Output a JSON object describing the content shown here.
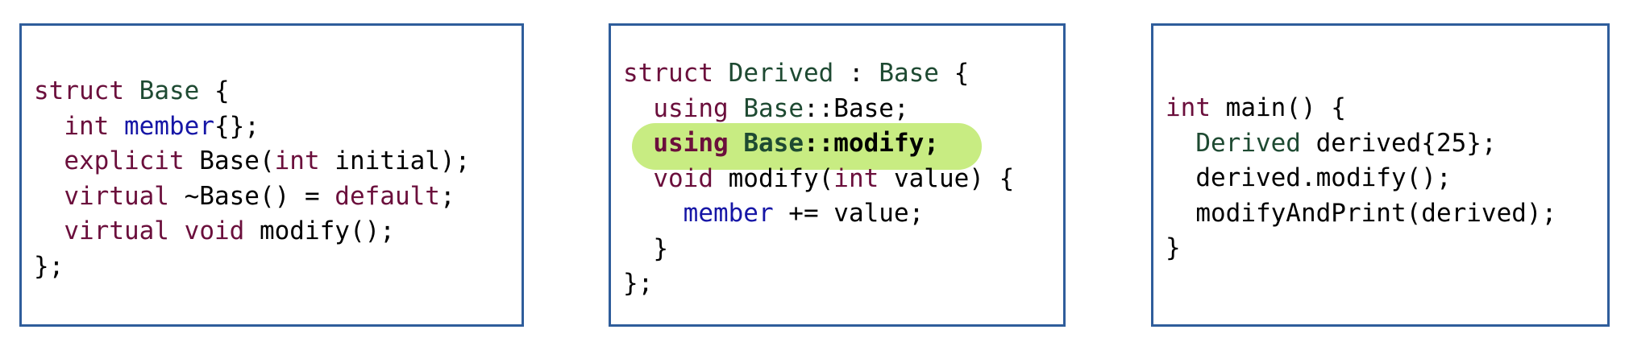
{
  "boxes": {
    "base": {
      "lines": [
        [
          {
            "t": "struct ",
            "c": "kw"
          },
          {
            "t": "Base",
            "c": "ty"
          },
          {
            "t": " {",
            "c": "tx"
          }
        ],
        [
          {
            "t": "  ",
            "c": "tx"
          },
          {
            "t": "int",
            "c": "kw"
          },
          {
            "t": " ",
            "c": "tx"
          },
          {
            "t": "member",
            "c": "mb"
          },
          {
            "t": "{};",
            "c": "tx"
          }
        ],
        [
          {
            "t": "  ",
            "c": "tx"
          },
          {
            "t": "explicit",
            "c": "kw"
          },
          {
            "t": " Base(",
            "c": "tx"
          },
          {
            "t": "int",
            "c": "kw"
          },
          {
            "t": " initial);",
            "c": "tx"
          }
        ],
        [
          {
            "t": "  ",
            "c": "tx"
          },
          {
            "t": "virtual",
            "c": "kw"
          },
          {
            "t": " ~Base() = ",
            "c": "tx"
          },
          {
            "t": "default",
            "c": "kw"
          },
          {
            "t": ";",
            "c": "tx"
          }
        ],
        [
          {
            "t": "  ",
            "c": "tx"
          },
          {
            "t": "virtual",
            "c": "kw"
          },
          {
            "t": " ",
            "c": "tx"
          },
          {
            "t": "void",
            "c": "kw"
          },
          {
            "t": " modify();",
            "c": "tx"
          }
        ],
        [
          {
            "t": "};",
            "c": "tx"
          }
        ]
      ]
    },
    "derived": {
      "lines": [
        [
          {
            "t": "struct ",
            "c": "kw"
          },
          {
            "t": "Derived",
            "c": "ty"
          },
          {
            "t": " : ",
            "c": "tx"
          },
          {
            "t": "Base",
            "c": "ty"
          },
          {
            "t": " {",
            "c": "tx"
          }
        ],
        [
          {
            "t": "  ",
            "c": "tx"
          },
          {
            "t": "using",
            "c": "kw"
          },
          {
            "t": " ",
            "c": "tx"
          },
          {
            "t": "Base",
            "c": "ty"
          },
          {
            "t": "::Base;",
            "c": "tx"
          }
        ],
        [
          {
            "t": "  ",
            "c": "tx"
          },
          {
            "t": "using",
            "c": "kw",
            "hl": true
          },
          {
            "t": " ",
            "c": "tx",
            "hl": true
          },
          {
            "t": "Base",
            "c": "ty",
            "hl": true
          },
          {
            "t": "::modify;",
            "c": "tx",
            "hl": true
          }
        ],
        [
          {
            "t": "  ",
            "c": "tx"
          },
          {
            "t": "void",
            "c": "kw"
          },
          {
            "t": " modify(",
            "c": "tx"
          },
          {
            "t": "int",
            "c": "kw"
          },
          {
            "t": " value) {",
            "c": "tx"
          }
        ],
        [
          {
            "t": "    ",
            "c": "tx"
          },
          {
            "t": "member",
            "c": "mb"
          },
          {
            "t": " += value;",
            "c": "tx"
          }
        ],
        [
          {
            "t": "  }",
            "c": "tx"
          }
        ],
        [
          {
            "t": "};",
            "c": "tx"
          }
        ]
      ]
    },
    "main": {
      "lines": [
        [
          {
            "t": "int",
            "c": "kw"
          },
          {
            "t": " main() {",
            "c": "tx"
          }
        ],
        [
          {
            "t": "  ",
            "c": "tx"
          },
          {
            "t": "Derived",
            "c": "ty"
          },
          {
            "t": " derived{25};",
            "c": "tx"
          }
        ],
        [
          {
            "t": "  derived.modify();",
            "c": "tx"
          }
        ],
        [
          {
            "t": "  modifyAndPrint(derived);",
            "c": "tx"
          }
        ],
        [
          {
            "t": "}",
            "c": "tx"
          }
        ]
      ]
    }
  },
  "colors": {
    "border": "#2f5d9b",
    "keyword": "#6b0f3c",
    "type": "#1e4a32",
    "member": "#1616a6",
    "highlight": "#c8ec82"
  }
}
